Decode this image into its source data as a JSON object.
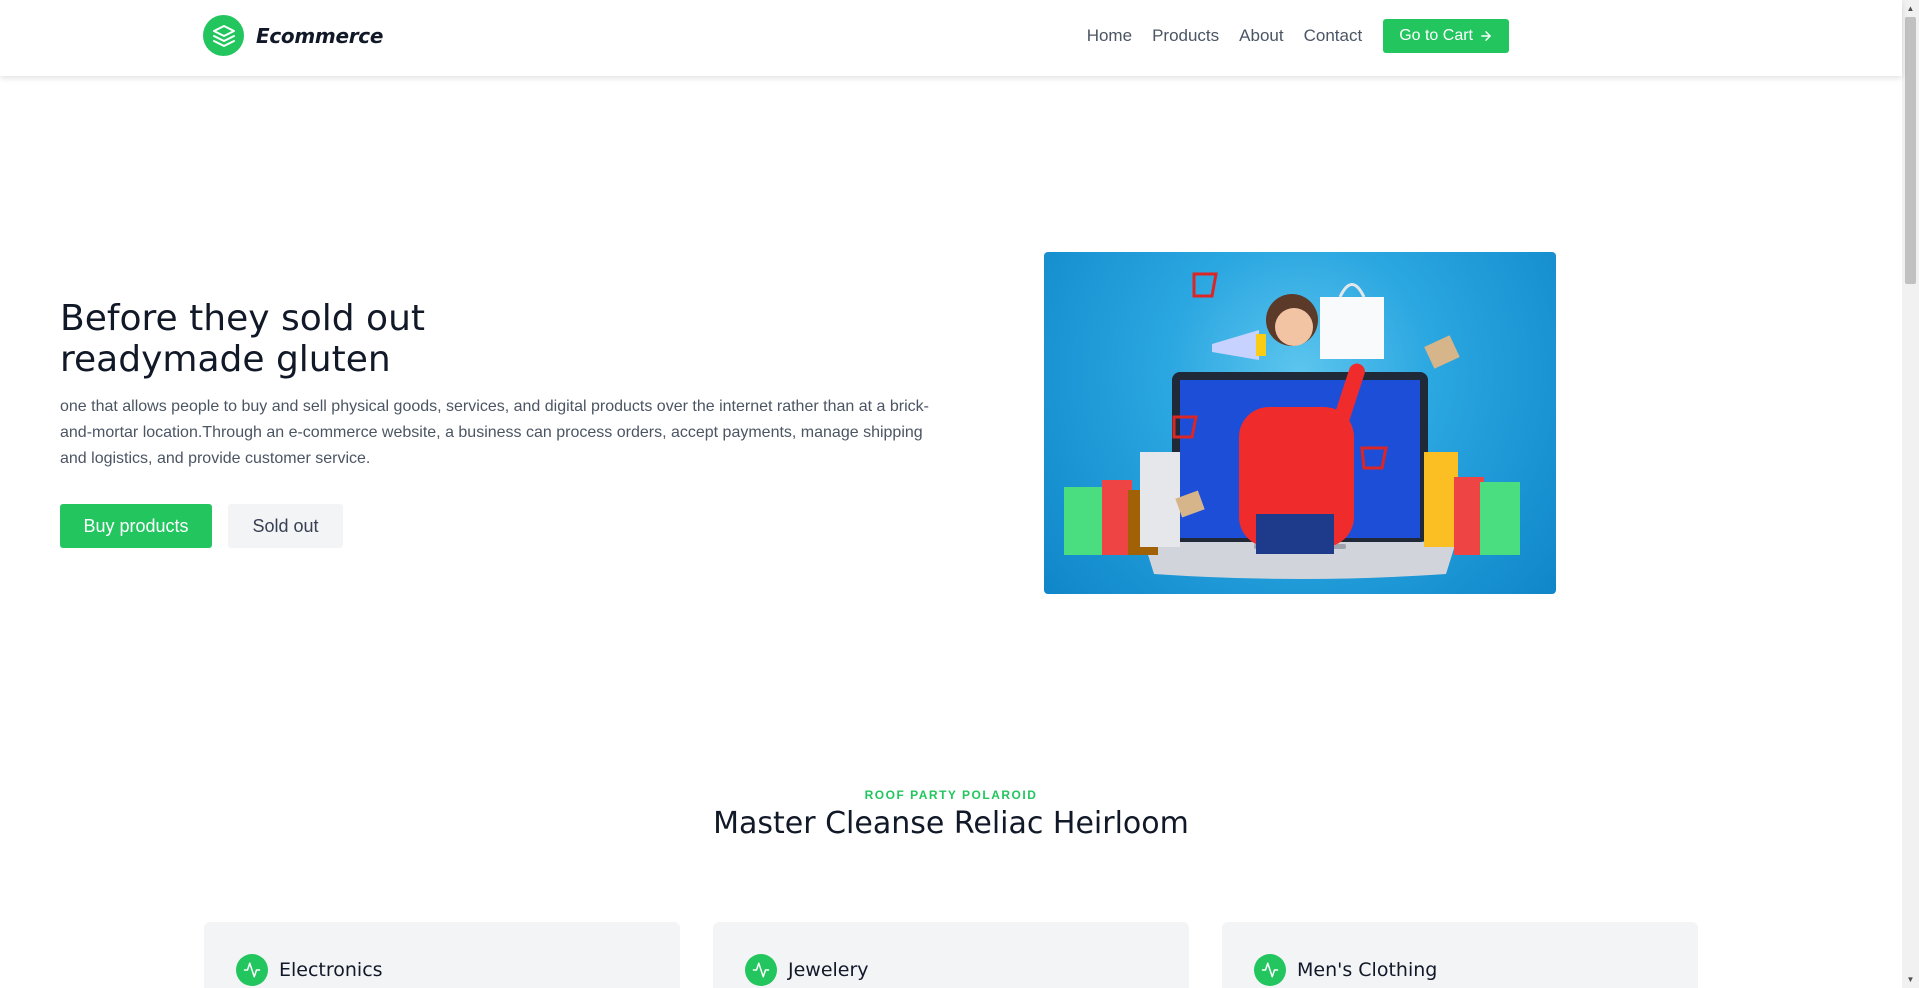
{
  "header": {
    "brand_name": "Ecommerce",
    "brand_icon": "stack-layers-icon",
    "nav": [
      "Home",
      "Products",
      "About",
      "Contact"
    ],
    "cart_label": "Go to Cart",
    "cart_icon": "arrow-right-icon"
  },
  "hero": {
    "title_line1": "Before they sold out",
    "title_line2": "readymade gluten",
    "description": "one that allows people to buy and sell physical goods, services, and digital products over the internet rather than at a brick-and-mortar location.Through an e-commerce website, a business can process orders, accept payments, manage shipping and logistics, and provide customer service.",
    "primary_button": "Buy products",
    "secondary_button": "Sold out",
    "image_alt": "woman with megaphone shopping on laptop"
  },
  "section": {
    "eyebrow": "ROOF PARTY POLAROID",
    "title": "Master Cleanse Reliac Heirloom",
    "categories": [
      "Electronics",
      "Jewelery",
      "Men's Clothing"
    ],
    "category_icon": "activity-pulse-icon"
  },
  "colors": {
    "accent": "#22c55e",
    "text_dark": "#111827",
    "text_muted": "#4b5563",
    "card_bg": "#f3f4f6"
  }
}
